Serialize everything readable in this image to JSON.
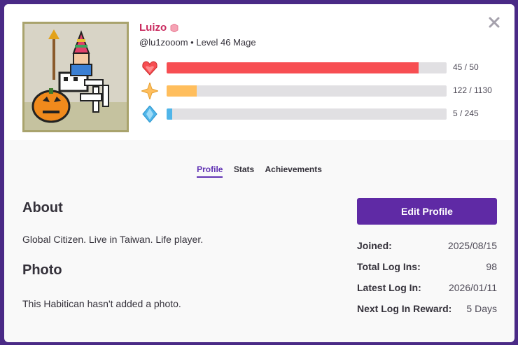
{
  "user": {
    "display_name": "Luizo",
    "handle_line": "@lu1zooom • Level 46 Mage"
  },
  "bars": [
    {
      "name": "health",
      "icon": "heart-icon",
      "value": "45 / 50",
      "fraction": 0.9,
      "color": "#f74e52"
    },
    {
      "name": "experience",
      "icon": "star-icon",
      "value": "122 / 1130",
      "fraction": 0.108,
      "color": "#ffbe5d"
    },
    {
      "name": "mana",
      "icon": "mana-gem-icon",
      "value": "5 / 245",
      "fraction": 0.02,
      "color": "#50b5e9"
    }
  ],
  "tabs": [
    {
      "label": "Profile",
      "active": true
    },
    {
      "label": "Stats",
      "active": false
    },
    {
      "label": "Achievements",
      "active": false
    }
  ],
  "about": {
    "heading": "About",
    "text": "Global Citizen. Live in Taiwan. Life player."
  },
  "photo": {
    "heading": "Photo",
    "text": "This Habitican hasn't added a photo."
  },
  "edit_label": "Edit Profile",
  "info": [
    {
      "label": "Joined:",
      "value": "2025/08/15"
    },
    {
      "label": "Total Log Ins:",
      "value": "98"
    },
    {
      "label": "Latest Log In:",
      "value": "2026/01/11"
    },
    {
      "label": "Next Log In Reward:",
      "value": "5 Days"
    }
  ],
  "colors": {
    "accent": "#6133b4",
    "name": "#c92b5f"
  }
}
